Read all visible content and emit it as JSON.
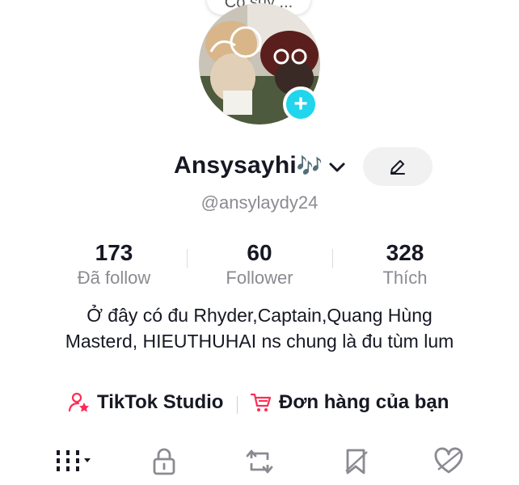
{
  "profile": {
    "note_text": "Có suy ...",
    "display_name": "Ansysayhi",
    "name_emoji": "🎶",
    "username": "@ansylaydy24",
    "bio": "Ở đây có đu Rhyder,Captain,Quang Hùng Masterd, HIEUTHUHAI ns chung là đu tùm lum"
  },
  "stats": [
    {
      "value": "173",
      "label": "Đã follow"
    },
    {
      "value": "60",
      "label": "Follower"
    },
    {
      "value": "328",
      "label": "Thích"
    }
  ],
  "links": {
    "studio": "TikTok Studio",
    "orders": "Đơn hàng của bạn"
  },
  "tabs": [
    {
      "icon": "grid-videos-icon"
    },
    {
      "icon": "lock-icon"
    },
    {
      "icon": "repost-icon"
    },
    {
      "icon": "bookmark-favorites-icon"
    },
    {
      "icon": "heart-liked-icon"
    }
  ],
  "colors": {
    "add_badge": "#20d5ec",
    "accent_red": "#fe2c55",
    "muted_text": "#8a8b91",
    "edit_button_bg": "#f1f1f2"
  }
}
